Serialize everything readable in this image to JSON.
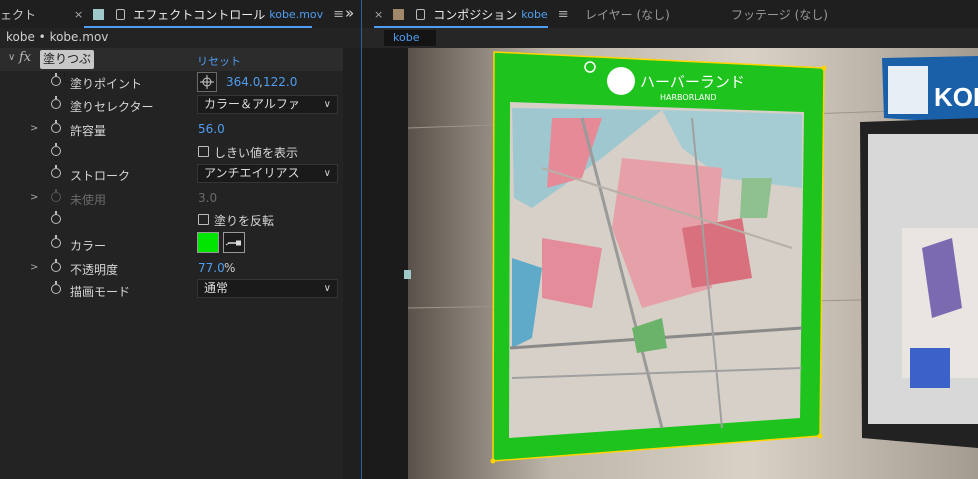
{
  "left_panel": {
    "prev_tab_label": "ェクト",
    "tab": {
      "close": "×",
      "title": "エフェクトコントロール",
      "subtitle": "kobe.mov",
      "menu": "≡"
    },
    "collapse_glyph": "»",
    "breadcrumb": "kobe • kobe.mov",
    "effect": {
      "fx": "fx",
      "name": "塗りつぶし",
      "reset": "リセット"
    },
    "props": {
      "fill_point": {
        "label": "塗りポイント",
        "x": "364.0",
        "sep": ",",
        "y": "122.0"
      },
      "fill_selector": {
        "label": "塗りセレクター",
        "value": "カラー＆アルファ"
      },
      "tolerance": {
        "label": "許容量",
        "value": "56.0"
      },
      "show_threshold": {
        "label": "しきい値を表示"
      },
      "stroke": {
        "label": "ストローク",
        "value": "アンチエイリアス"
      },
      "unused": {
        "label": "未使用",
        "value": "3.0"
      },
      "invert_fill": {
        "label": "塗りを反転"
      },
      "color": {
        "label": "カラー",
        "swatch": "#00e600"
      },
      "opacity": {
        "label": "不透明度",
        "value": "77.0",
        "unit": "%"
      },
      "blend_mode": {
        "label": "描画モード",
        "value": "通常"
      }
    }
  },
  "right_panel": {
    "tab": {
      "close": "×",
      "title": "コンポジション",
      "subtitle": "kobe",
      "menu": "≡"
    },
    "other_tabs": [
      "レイヤー (なし)",
      "フッテージ (なし)"
    ],
    "comp_chip": "kobe",
    "sign": {
      "title_jp": "ハーバーランド",
      "title_en": "HARBORLAND",
      "right_sign": "KOBE"
    }
  },
  "colors": {
    "accent": "#4f9df0",
    "fill_green": "#1ec31e",
    "swatch": "#00e600"
  }
}
